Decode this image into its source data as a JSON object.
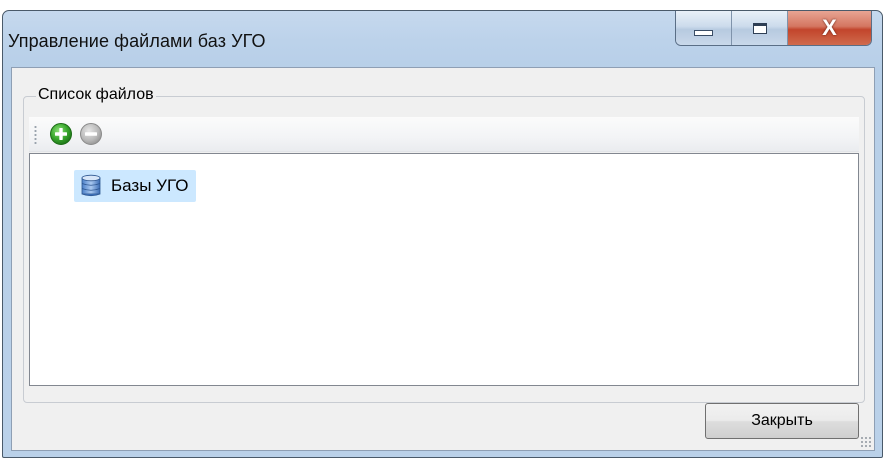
{
  "window": {
    "title": "Управление файлами баз УГО",
    "controls": {
      "minimize_icon": "minimize-icon",
      "maximize_icon": "maximize-icon",
      "close_icon": "close-icon",
      "close_glyph": "X"
    }
  },
  "files_group": {
    "title": "Список файлов",
    "toolbar": {
      "buttons": [
        {
          "name": "add",
          "icon": "add-icon",
          "enabled": true,
          "color": "#3aa82e"
        },
        {
          "name": "remove",
          "icon": "remove-icon",
          "enabled": false,
          "color": "#b8b8b8"
        }
      ]
    },
    "tree": {
      "items": [
        {
          "label": "Базы УГО",
          "icon": "database-icon",
          "selected": true
        }
      ]
    }
  },
  "footer": {
    "close_label": "Закрыть"
  },
  "colors": {
    "titlebar": "#bcd2ea",
    "selection": "#cce8ff",
    "client": "#f0f0f0"
  }
}
